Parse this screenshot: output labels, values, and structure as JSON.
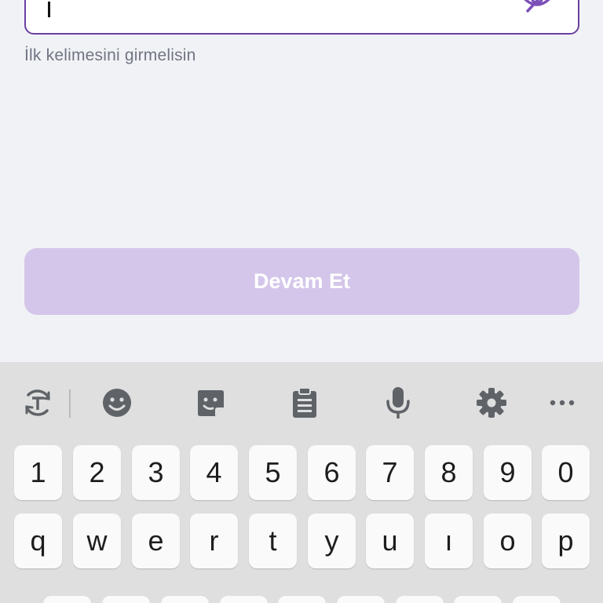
{
  "password_field": {
    "value": ""
  },
  "helper_text": "İlk kelimesini girmelisin",
  "continue_button": {
    "label": "Devam Et"
  },
  "colors": {
    "accent": "#6b3fa0",
    "button_disabled": "#d4c6ea",
    "background": "#f1f2f5",
    "keyboard_bg": "#dfdfdf",
    "icon_gray": "#5f6368"
  },
  "keyboard": {
    "toolbar_icons": [
      "translate-icon",
      "emoji-icon",
      "sticker-icon",
      "clipboard-icon",
      "microphone-icon",
      "gear-icon",
      "more-icon"
    ],
    "number_row": [
      "1",
      "2",
      "3",
      "4",
      "5",
      "6",
      "7",
      "8",
      "9",
      "0"
    ],
    "letter_row": [
      "q",
      "w",
      "e",
      "r",
      "t",
      "y",
      "u",
      "ı",
      "o",
      "p"
    ]
  }
}
